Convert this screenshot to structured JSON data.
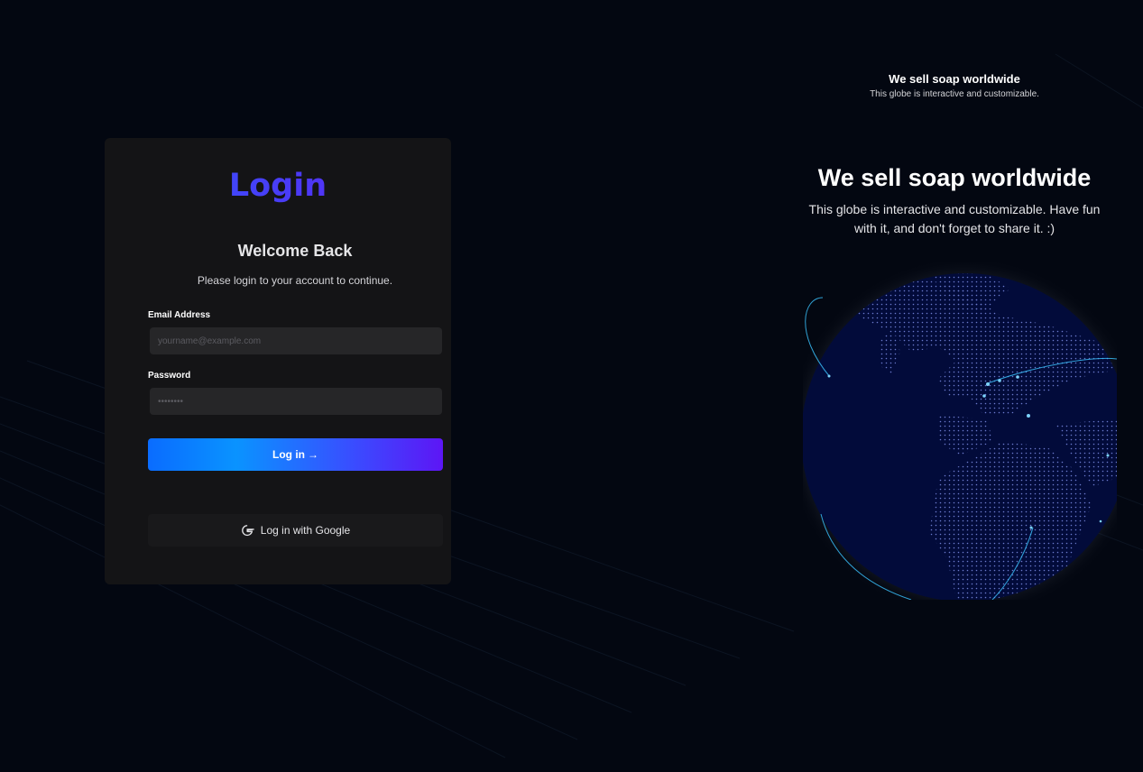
{
  "login": {
    "brand": "Login",
    "welcome": "Welcome Back",
    "subtitle": "Please login to your account to continue.",
    "email_label": "Email Address",
    "email_placeholder": "yourname@example.com",
    "password_label": "Password",
    "password_placeholder": "••••••••",
    "login_button": "Log in",
    "login_arrow": "→",
    "google_button": "Log in with Google"
  },
  "hero": {
    "small_title": "We sell soap worldwide",
    "small_subtitle": "This globe is interactive and customizable.",
    "title": "We sell soap worldwide",
    "subtitle": "This globe is interactive and customizable. Have fun with it, and don't forget to share it. :)"
  },
  "colors": {
    "background": "#030711",
    "card": "#141416",
    "input": "#262628",
    "accent_blue": "#0a93ff",
    "accent_purple": "#5d16f5",
    "globe": "#020b3a"
  },
  "icons": {
    "google": "google-icon",
    "arrow": "arrow-right-icon"
  }
}
